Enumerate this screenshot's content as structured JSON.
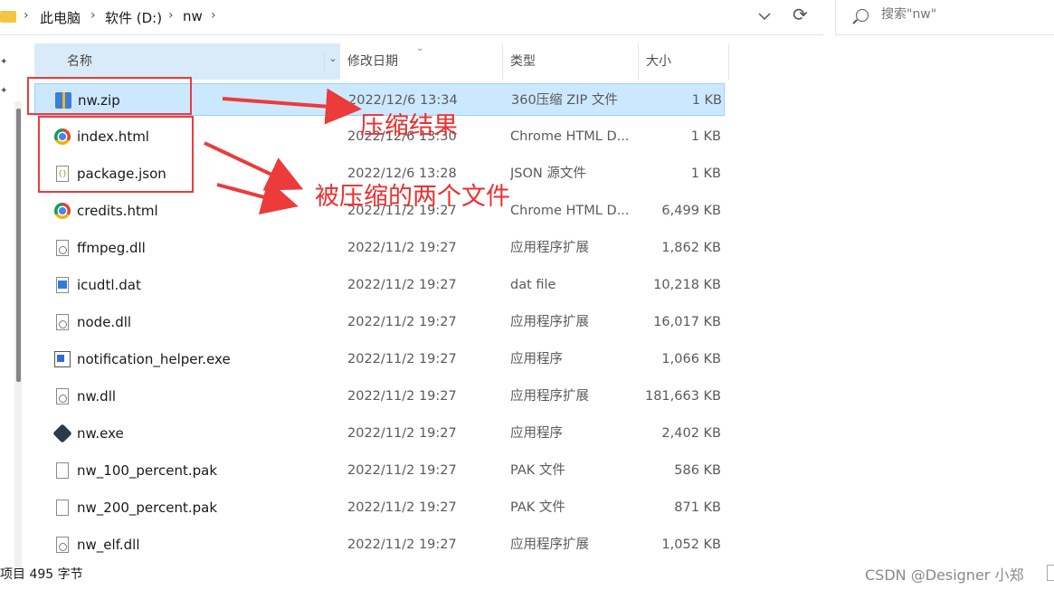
{
  "breadcrumb": {
    "items": [
      "此电脑",
      "软件 (D:)",
      "nw"
    ]
  },
  "search": {
    "placeholder": "搜索\"nw\""
  },
  "columns": {
    "name": "名称",
    "date": "修改日期",
    "type": "类型",
    "size": "大小"
  },
  "files": [
    {
      "name": "nw.zip",
      "date": "2022/12/6 13:34",
      "type": "360压缩 ZIP 文件",
      "size": "1 KB",
      "icon": "zip-icon",
      "selected": true
    },
    {
      "name": "index.html",
      "date": "2022/12/6 13:30",
      "type": "Chrome HTML D...",
      "size": "1 KB",
      "icon": "chrome-icon"
    },
    {
      "name": "package.json",
      "date": "2022/12/6 13:28",
      "type": "JSON 源文件",
      "size": "1 KB",
      "icon": "json-file-icon"
    },
    {
      "name": "credits.html",
      "date": "2022/11/2 19:27",
      "type": "Chrome HTML D...",
      "size": "6,499 KB",
      "icon": "chrome-icon"
    },
    {
      "name": "ffmpeg.dll",
      "date": "2022/11/2 19:27",
      "type": "应用程序扩展",
      "size": "1,862 KB",
      "icon": "dll-icon"
    },
    {
      "name": "icudtl.dat",
      "date": "2022/11/2 19:27",
      "type": "dat file",
      "size": "10,218 KB",
      "icon": "dat-icon"
    },
    {
      "name": "node.dll",
      "date": "2022/11/2 19:27",
      "type": "应用程序扩展",
      "size": "16,017 KB",
      "icon": "dll-icon"
    },
    {
      "name": "notification_helper.exe",
      "date": "2022/11/2 19:27",
      "type": "应用程序",
      "size": "1,066 KB",
      "icon": "exe-icon"
    },
    {
      "name": "nw.dll",
      "date": "2022/11/2 19:27",
      "type": "应用程序扩展",
      "size": "181,663 KB",
      "icon": "dll-icon"
    },
    {
      "name": "nw.exe",
      "date": "2022/11/2 19:27",
      "type": "应用程序",
      "size": "2,402 KB",
      "icon": "nw-exe-icon"
    },
    {
      "name": "nw_100_percent.pak",
      "date": "2022/11/2 19:27",
      "type": "PAK 文件",
      "size": "586 KB",
      "icon": "file-icon"
    },
    {
      "name": "nw_200_percent.pak",
      "date": "2022/11/2 19:27",
      "type": "PAK 文件",
      "size": "871 KB",
      "icon": "file-icon"
    },
    {
      "name": "nw_elf.dll",
      "date": "2022/11/2 19:27",
      "type": "应用程序扩展",
      "size": "1,052 KB",
      "icon": "dll-icon"
    }
  ],
  "annotations": {
    "compress_result": "压缩结果",
    "compressed_files": "被压缩的两个文件",
    "color": "#ec3b3b"
  },
  "status": {
    "text": "项目  495 字节"
  },
  "watermark": "CSDN @Designer 小郑"
}
